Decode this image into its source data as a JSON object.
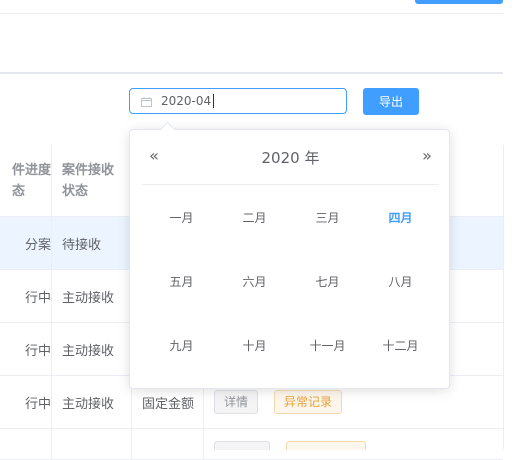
{
  "date_filter": {
    "value": "2020-04",
    "icon": "calendar-icon"
  },
  "export_label": "导出",
  "colors": {
    "primary": "#409eff",
    "warning": "#e6a23c",
    "row_highlight": "#ecf5ff"
  },
  "table": {
    "headers": {
      "progress": "件进度\n态",
      "receive_status": "案件接收\n状态"
    },
    "rows": [
      {
        "progress": "分案",
        "receive": "待接收",
        "amount": "",
        "highlighted": true
      },
      {
        "progress": "行中",
        "receive": "主动接收",
        "amount": ""
      },
      {
        "progress": "行中",
        "receive": "主动接收",
        "amount": ""
      },
      {
        "progress": "行中",
        "receive": "主动接收",
        "amount": "固定金额",
        "detail_label": "详情",
        "abnormal_label": "异常记录"
      }
    ]
  },
  "picker": {
    "year_label": "2020 年",
    "prev_icon": "«",
    "next_icon": "»",
    "months": [
      "一月",
      "二月",
      "三月",
      "四月",
      "五月",
      "六月",
      "七月",
      "八月",
      "九月",
      "十月",
      "十一月",
      "十二月"
    ],
    "current_month_index": 3
  }
}
